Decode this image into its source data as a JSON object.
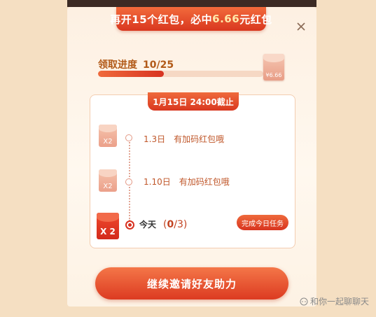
{
  "banner": {
    "prefix": "再开15个红包，必中",
    "amount": "6.66",
    "suffix": "元红包"
  },
  "progress": {
    "label": "领取进度",
    "count": "10/25",
    "fraction": 0.4,
    "target_amount": "¥6.66"
  },
  "deadline": "1月15日 24:00截止",
  "tasks": [
    {
      "date": "1.3日",
      "text": "有加码红包哦",
      "multiplier": "X2"
    },
    {
      "date": "1.10日",
      "text": "有加码红包哦",
      "multiplier": "X2"
    }
  ],
  "today": {
    "label": "今天",
    "progress_open": "(",
    "progress_done": "0",
    "progress_total": "/3)",
    "multiplier": "X 2",
    "button": "完成今日任务"
  },
  "invite_button": "继续邀请好友助力",
  "watermark": "和你一起聊聊天",
  "colors": {
    "accent": "#d9371f",
    "text_brown": "#b25a18",
    "background": "#f5dfc2"
  }
}
